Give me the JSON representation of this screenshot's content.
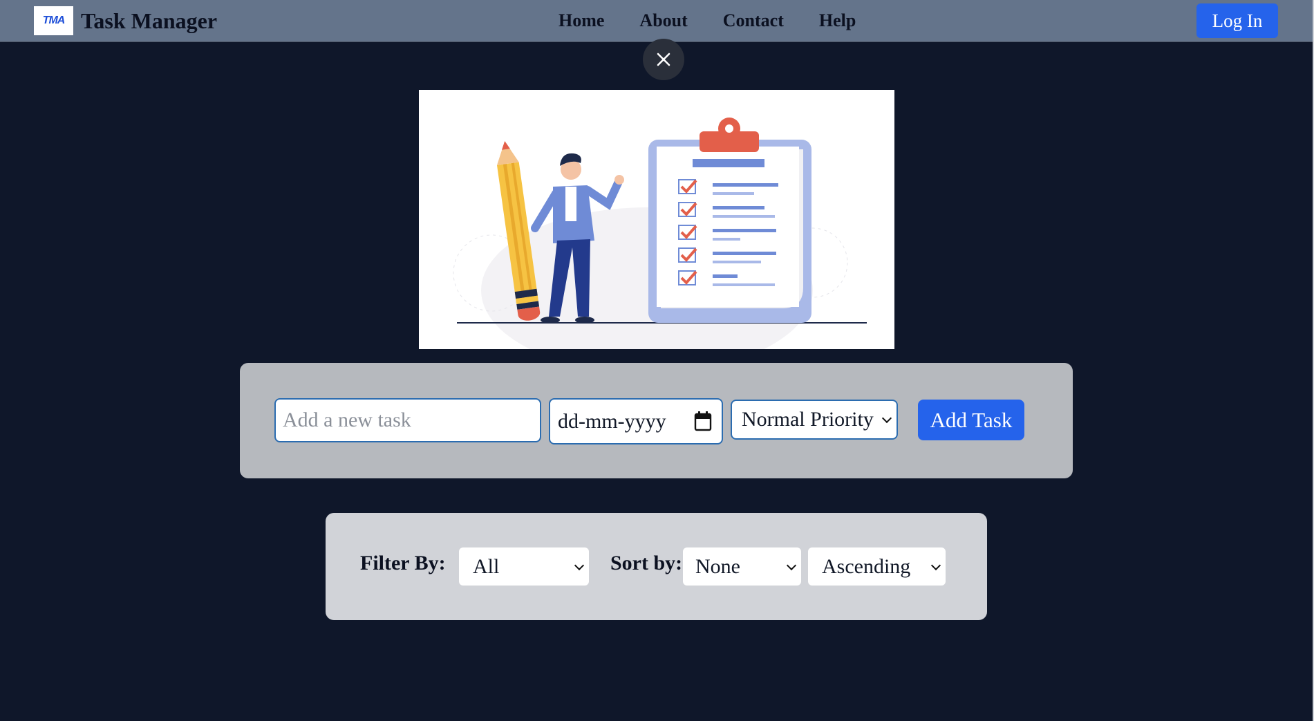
{
  "navbar": {
    "logo_text": "TMA",
    "app_title": "Task Manager",
    "links": [
      "Home",
      "About",
      "Contact",
      "Help"
    ],
    "login_label": "Log In"
  },
  "hero": {
    "icons": [
      "close-icon",
      "task-illustration"
    ]
  },
  "task_form": {
    "task_placeholder": "Add a new task",
    "date_placeholder": "dd-mm-yyyy",
    "priority_selected": "Normal Priority",
    "add_label": "Add Task"
  },
  "filters": {
    "filter_label": "Filter By:",
    "filter_selected": "All",
    "sort_label": "Sort by:",
    "sort_selected": "None",
    "order_selected": "Ascending"
  },
  "colors": {
    "background": "#0f172a",
    "navbar": "#64748b",
    "accent": "#2563eb",
    "form_panel": "#b6b9be",
    "filter_panel": "#d1d3d8"
  }
}
